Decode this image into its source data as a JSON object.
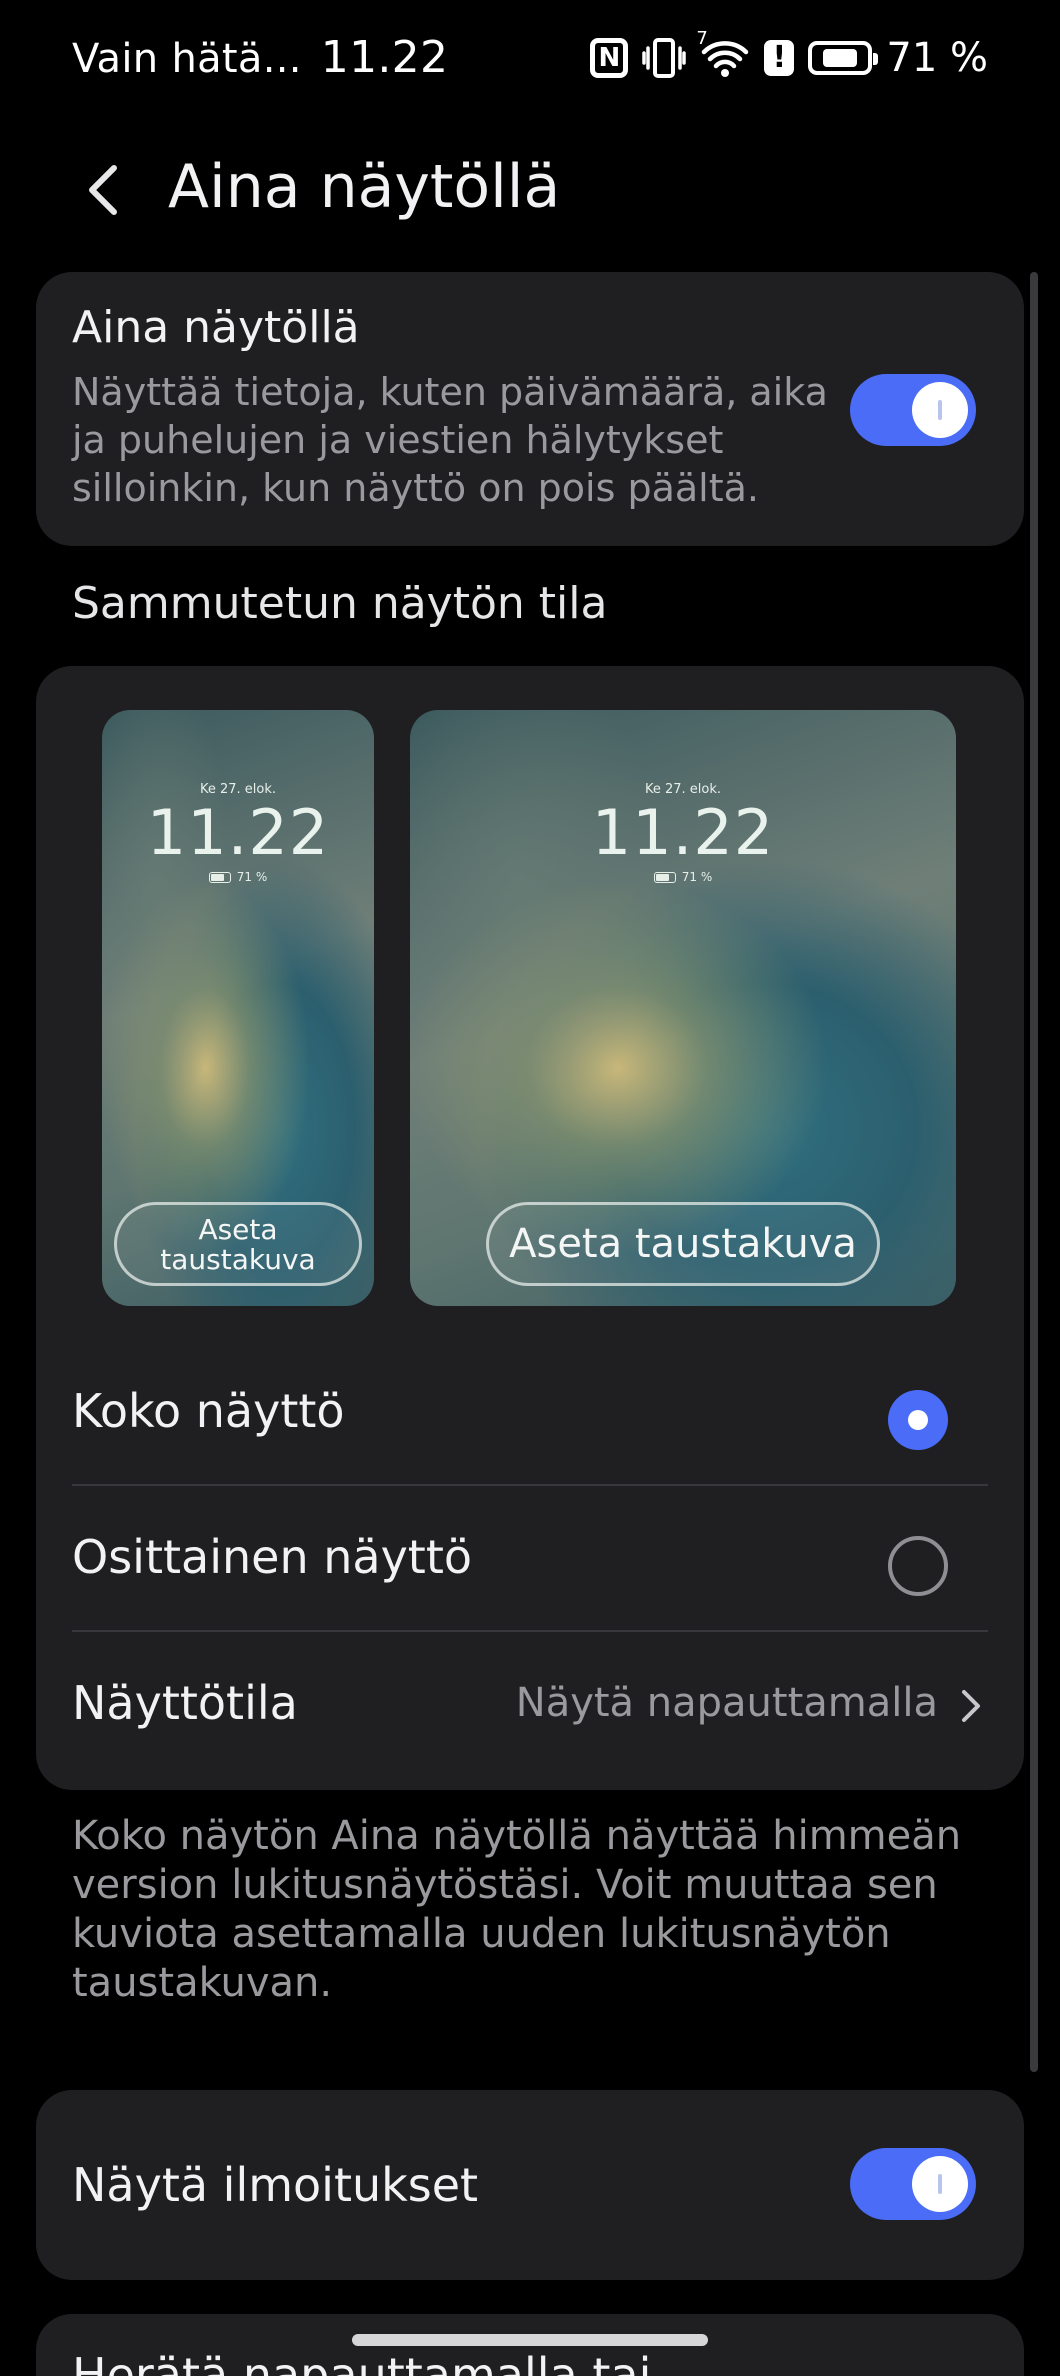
{
  "status_bar": {
    "carrier": "Vain hätä...",
    "time": "11.22",
    "battery_text": "71 %",
    "network_badge": "7",
    "icons": [
      "nfc-icon",
      "vibrate-icon",
      "wifi-icon",
      "alert-icon",
      "battery-icon"
    ]
  },
  "header": {
    "back_icon": "back-arrow-icon",
    "title": "Aina näytöllä"
  },
  "aod_card": {
    "title": "Aina näytöllä",
    "description": "Näyttää tietoja, kuten päivämäärä, aika ja puhelujen ja viestien hälytykset silloinkin, kun näyttö on pois päältä.",
    "enabled": true
  },
  "section_title": "Sammutetun näytön tila",
  "previews": {
    "date": "Ke 27. elok.",
    "time": "11.22",
    "battery": "71 %",
    "small_button": "Aseta taustakuva",
    "large_button": "Aseta taustakuva"
  },
  "options": [
    {
      "label": "Koko näyttö",
      "selected": true
    },
    {
      "label": "Osittainen näyttö",
      "selected": false
    }
  ],
  "display_mode": {
    "label": "Näyttötila",
    "value": "Näytä napauttamalla"
  },
  "footnote": "Koko näytön Aina näytöllä näyttää himmeän version lukitusnäytöstäsi. Voit muuttaa sen kuviota asettamalla uuden lukitusnäytön taustakuvan.",
  "notifications": {
    "label": "Näytä ilmoitukset",
    "enabled": true
  },
  "wake_row": {
    "label": "Herätä napauttamalla tai"
  },
  "colors": {
    "accent": "#4a6cf7",
    "card": "#1f1f22",
    "background": "#000000"
  }
}
